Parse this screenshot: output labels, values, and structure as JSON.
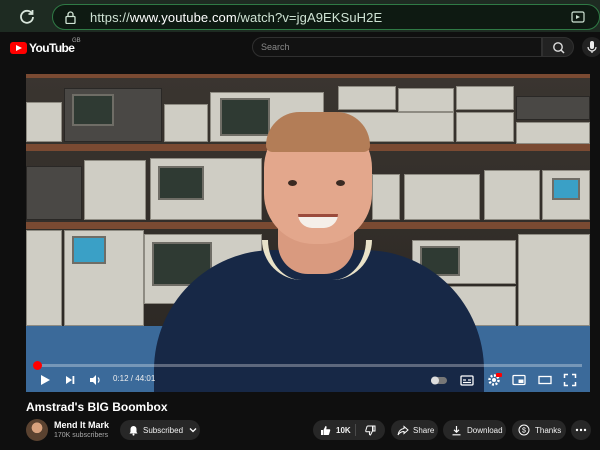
{
  "browser": {
    "url_prefix": "https://",
    "url_host": "www.youtube.com",
    "url_path": "/watch?v=jgA9EKSuH2E"
  },
  "header": {
    "logo_text": "YouTube",
    "country_code": "GB",
    "search_placeholder": "Search"
  },
  "player": {
    "current_time": "0:12",
    "duration": "44:01",
    "progress_fraction": 0.0045,
    "accent_color": "#ff0000"
  },
  "video": {
    "title": "Amstrad's BIG Boombox"
  },
  "channel": {
    "name": "Mend It Mark",
    "subscribers": "170K subscribers",
    "subscribed_label": "Subscribed"
  },
  "actions": {
    "like_count": "10K",
    "share_label": "Share",
    "download_label": "Download",
    "thanks_label": "Thanks"
  },
  "icons": [
    "reload-icon",
    "lock-icon",
    "site-settings-icon",
    "youtube-logo-icon",
    "search-icon",
    "mic-icon",
    "play-icon",
    "next-icon",
    "volume-icon",
    "autoplay-toggle",
    "subtitles-icon",
    "settings-icon",
    "miniplayer-icon",
    "theater-icon",
    "fullscreen-icon",
    "bell-icon",
    "chevron-down-icon",
    "thumbs-up-icon",
    "thumbs-down-icon",
    "share-icon",
    "download-icon",
    "thanks-icon",
    "more-icon"
  ]
}
